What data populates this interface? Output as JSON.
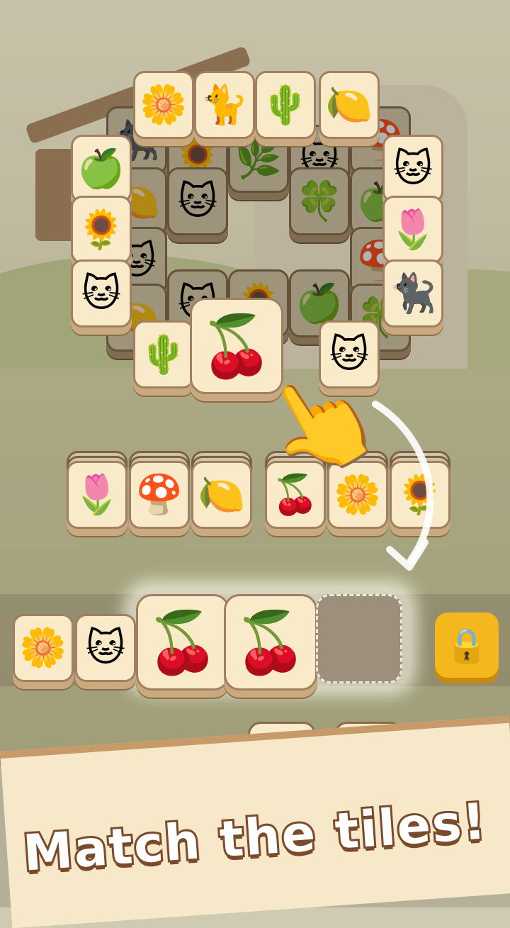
{
  "caption": "Match the tiles!",
  "colors": {
    "tile_face": "#f9ebc9",
    "tile_border": "#a08060",
    "lock": "#f5b71e",
    "caption_stroke": "#7a4a2a"
  },
  "board_back": [
    {
      "icon": "black-cat-icon",
      "glyph": "🐈‍⬛"
    },
    {
      "icon": "sunflower-icon",
      "glyph": "🌻"
    },
    {
      "icon": "leaf-icon",
      "glyph": "🌿"
    },
    {
      "icon": "cat-icon",
      "glyph": "🐱"
    },
    {
      "icon": "mushroom-icon",
      "glyph": "🍄"
    },
    {
      "icon": "lemon-icon",
      "glyph": "🍋"
    },
    {
      "icon": "cat-icon",
      "glyph": "🐱"
    },
    {
      "icon": "clover-icon",
      "glyph": "🍀"
    },
    {
      "icon": "apple-icon",
      "glyph": "🍏"
    },
    {
      "icon": "cat-icon",
      "glyph": "🐱"
    },
    {
      "icon": "mushroom-icon",
      "glyph": "🍄"
    },
    {
      "icon": "cat-icon",
      "glyph": "🐱"
    },
    {
      "icon": "sunflower-icon",
      "glyph": "🌻"
    },
    {
      "icon": "apple-icon",
      "glyph": "🍏"
    },
    {
      "icon": "clover-icon",
      "glyph": "🍀"
    },
    {
      "icon": "lemon-icon",
      "glyph": "🍋"
    }
  ],
  "board_front": [
    {
      "icon": "daisy-icon",
      "glyph": "🌼"
    },
    {
      "icon": "fluffy-cat-icon",
      "glyph": "🐈"
    },
    {
      "icon": "cactus-icon",
      "glyph": "🌵"
    },
    {
      "icon": "lemon-icon",
      "glyph": "🍋"
    },
    {
      "icon": "green-apple-icon",
      "glyph": "🍏"
    },
    {
      "icon": "sunflower-icon",
      "glyph": "🌻"
    },
    {
      "icon": "blue-cat-icon",
      "glyph": "🐱"
    },
    {
      "icon": "blue-cat-icon",
      "glyph": "🐱"
    },
    {
      "icon": "tulip-icon",
      "glyph": "🌷"
    },
    {
      "icon": "black-cat-icon",
      "glyph": "🐈‍⬛"
    },
    {
      "icon": "cactus-icon",
      "glyph": "🌵"
    },
    {
      "icon": "witch-cat-icon",
      "glyph": "🐱"
    }
  ],
  "selected_tile": {
    "icon": "cherry-icon",
    "glyph": "🍒"
  },
  "row_tiles": [
    {
      "icon": "tulip-icon",
      "glyph": "🌷"
    },
    {
      "icon": "mushroom-icon",
      "glyph": "🍄"
    },
    {
      "icon": "lemon-icon",
      "glyph": "🍋"
    },
    {
      "icon": "cherry-icon",
      "glyph": "🍒"
    },
    {
      "icon": "daisy-icon",
      "glyph": "🌼"
    },
    {
      "icon": "sunflower-icon",
      "glyph": "🌻"
    }
  ],
  "tray_tiles": [
    {
      "icon": "daisy-icon",
      "glyph": "🌼"
    },
    {
      "icon": "witch-cat-icon",
      "glyph": "🐱"
    },
    {
      "icon": "cherry-icon",
      "glyph": "🍒"
    },
    {
      "icon": "cherry-icon",
      "glyph": "🍒"
    }
  ],
  "lock_glyph": "🔒",
  "powerups": [
    {
      "icon": "frog-icon",
      "glyph": "🐸"
    },
    {
      "icon": "shuffle-icon",
      "glyph": "🔄"
    },
    {
      "icon": "hint-icon",
      "glyph": "💡"
    }
  ],
  "hand_glyph": "👆"
}
